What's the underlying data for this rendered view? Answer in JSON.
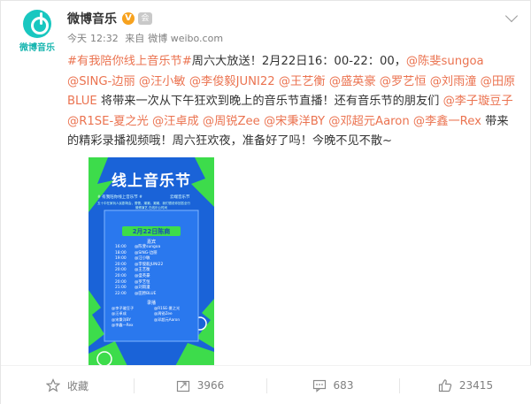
{
  "account": {
    "avatar_label": "微博音乐",
    "username": "微博音乐",
    "verified_badge": "V",
    "vip_badge": "会"
  },
  "meta": {
    "date": "今天",
    "time": "12:32",
    "source_prefix": "来自",
    "source": "微博 weibo.com"
  },
  "post": {
    "segments": [
      {
        "t": "#有我陪你线上音乐节#",
        "c": "tag"
      },
      {
        "t": "周六大放送！2月22日16：00-22：00，",
        "c": "text"
      },
      {
        "t": "@陈斐sungoa",
        "c": "link"
      },
      {
        "t": " ",
        "c": "text"
      },
      {
        "t": "@SING-边丽",
        "c": "link"
      },
      {
        "t": " ",
        "c": "text"
      },
      {
        "t": "@汪小敏",
        "c": "link"
      },
      {
        "t": " ",
        "c": "text"
      },
      {
        "t": "@李俊毅JUNI22",
        "c": "link"
      },
      {
        "t": " ",
        "c": "text"
      },
      {
        "t": "@王艺衡",
        "c": "link"
      },
      {
        "t": " ",
        "c": "text"
      },
      {
        "t": "@盛英豪",
        "c": "link"
      },
      {
        "t": " ",
        "c": "text"
      },
      {
        "t": "@罗艺恒",
        "c": "link"
      },
      {
        "t": " ",
        "c": "text"
      },
      {
        "t": "@刘雨潼",
        "c": "link"
      },
      {
        "t": " ",
        "c": "text"
      },
      {
        "t": "@田原BLUE",
        "c": "link"
      },
      {
        "t": " 将带来一次从下午狂欢到晚上的音乐节直播！还有音乐节的朋友们 ",
        "c": "text"
      },
      {
        "t": "@李子璇豆子",
        "c": "link"
      },
      {
        "t": " ",
        "c": "text"
      },
      {
        "t": "@R1SE-夏之光",
        "c": "link"
      },
      {
        "t": " ",
        "c": "text"
      },
      {
        "t": "@汪卓成",
        "c": "link"
      },
      {
        "t": " ",
        "c": "text"
      },
      {
        "t": "@周锐Zee",
        "c": "link"
      },
      {
        "t": " ",
        "c": "text"
      },
      {
        "t": "@宋秉洋BY",
        "c": "link"
      },
      {
        "t": " ",
        "c": "text"
      },
      {
        "t": "@邓超元Aaron",
        "c": "link"
      },
      {
        "t": " ",
        "c": "text"
      },
      {
        "t": "@李鑫一Rex",
        "c": "link"
      },
      {
        "t": " 带来的精彩录播视频哦！周六狂欢夜，准备好了吗！今晚不见不散~",
        "c": "text"
      }
    ]
  },
  "poster": {
    "title": "线上音乐节",
    "hashtag": "# 有我陪你线上音乐节 #",
    "sub_tag": "云端音乐节",
    "desc1": "五十中在家玩人民剧场会，蕾蕾，潮潮，潮潮，我们很说你回答全行",
    "desc2": "微博演艺 在线乐公时间",
    "date_badge": "2月22日陈商",
    "section1": "嘉宾",
    "schedule": [
      {
        "time": "16:00",
        "name": "@陈斐sungoa"
      },
      {
        "time": "18:00",
        "name": "@SING-边丽"
      },
      {
        "time": "19:00",
        "name": "@汪小敏"
      },
      {
        "time": "20:00",
        "name": "@李俊毅JUNI22"
      },
      {
        "time": "20:00",
        "name": "@王艺衡"
      },
      {
        "time": "20:00",
        "name": "@盛英豪"
      },
      {
        "time": "20:00",
        "name": "@罗艺恒"
      },
      {
        "time": "21:00",
        "name": "@刘雨潼"
      },
      {
        "time": "22:00",
        "name": "@田原BLUE"
      }
    ],
    "section2": "录播",
    "replays": [
      [
        "@李子璇豆子",
        "@R1SE-夏之光"
      ],
      [
        "@汪卓成",
        "@周锐Zee"
      ],
      [
        "@宋秉洋BY",
        "@邓超元Aaron"
      ],
      [
        "@李鑫一Rex",
        ""
      ]
    ]
  },
  "actions": {
    "favorite": "收藏",
    "repost": "3966",
    "comment": "683",
    "like": "23415"
  },
  "colors": {
    "link": "#eb7350",
    "poster_blue": "#1a63d8",
    "poster_green": "#3ddc4b",
    "brand_teal": "#19c7c0"
  }
}
